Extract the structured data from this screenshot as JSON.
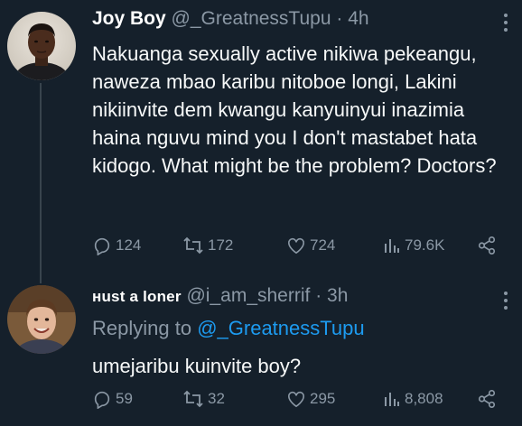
{
  "tweets": [
    {
      "author_name": "Joy Boy",
      "handle": "@_GreatnessTupu",
      "separator": "·",
      "time": "4h",
      "text": "Nakuanga sexually active nikiwa pekeangu, naweza mbao karibu nitoboe longi, Lakini nikiinvite dem kwangu kanyuinyui inazimia haina nguvu mind you I don't mastabet hata kidogo. What might be the problem? Doctors?",
      "replies": "124",
      "retweets": "172",
      "likes": "724",
      "views": "79.6K"
    },
    {
      "author_name": "ʜust a loner",
      "handle": "@i_am_sherrif",
      "separator": "·",
      "time": "3h",
      "replying_prefix": "Replying to",
      "replying_to": "@_GreatnessTupu",
      "text": "umejaribu kuinvite boy?",
      "replies": "59",
      "retweets": "32",
      "likes": "295",
      "views": "8,808"
    }
  ],
  "icons": {
    "reply": "reply-icon",
    "retweet": "retweet-icon",
    "like": "like-icon",
    "views": "views-icon",
    "share": "share-icon",
    "more": "more-icon"
  },
  "colors": {
    "background": "#15202b",
    "secondary_text": "#8b98a5",
    "accent": "#1d9bf0",
    "thread_line": "#38444d"
  }
}
